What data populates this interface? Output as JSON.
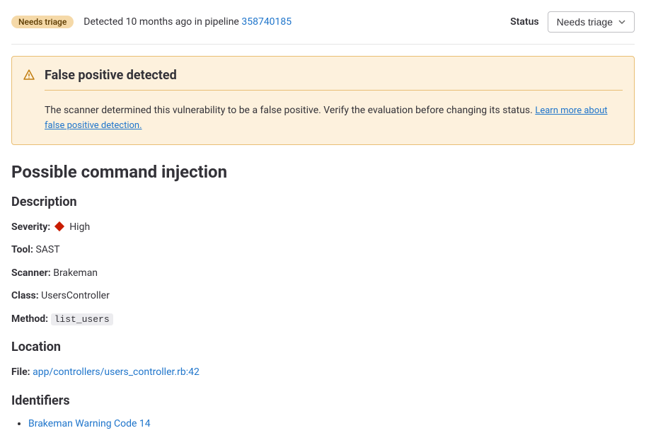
{
  "header": {
    "badge": "Needs triage",
    "detected_prefix": "Detected 10 months ago in pipeline ",
    "pipeline_id": "358740185",
    "status_label": "Status",
    "dropdown_label": "Needs triage"
  },
  "alert": {
    "title": "False positive detected",
    "body": "The scanner determined this vulnerability to be a false positive. Verify the evaluation before changing its status. ",
    "link_text": "Learn more about false positive detection."
  },
  "main_title": "Possible command injection",
  "description": {
    "heading": "Description",
    "severity_label": "Severity:",
    "severity_value": "High",
    "tool_label": "Tool:",
    "tool_value": "SAST",
    "scanner_label": "Scanner:",
    "scanner_value": "Brakeman",
    "class_label": "Class:",
    "class_value": "UsersController",
    "method_label": "Method:",
    "method_value": "list_users"
  },
  "location": {
    "heading": "Location",
    "file_label": "File:",
    "file_value": "app/controllers/users_controller.rb:42"
  },
  "identifiers": {
    "heading": "Identifiers",
    "items": [
      "Brakeman Warning Code 14"
    ]
  }
}
